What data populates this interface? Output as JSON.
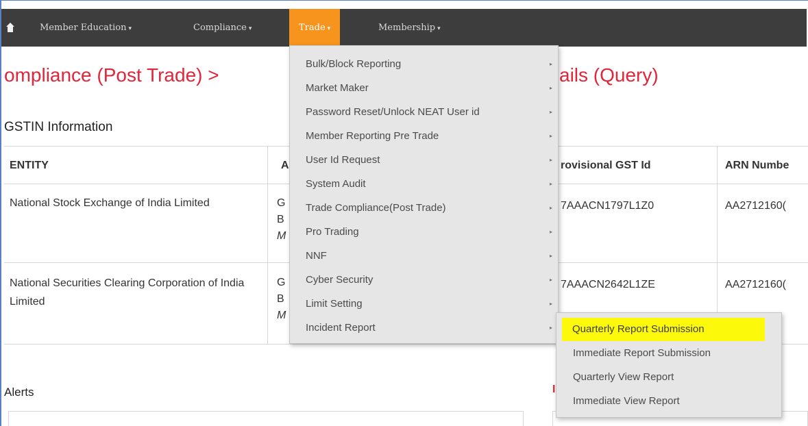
{
  "nav": {
    "items": [
      {
        "label": "Member Education",
        "caret": "▾"
      },
      {
        "label": "Compliance",
        "caret": "▾"
      },
      {
        "label": "Trade",
        "caret": "▾"
      },
      {
        "label": "Membership",
        "caret": "▾"
      }
    ],
    "active_color": "#f7941d"
  },
  "page": {
    "title": "ompliance (Post Trade) >",
    "title_tail": "ails (Query)",
    "title_color": "#e0263a"
  },
  "gstin": {
    "section_title": "GSTIN Information",
    "headers": {
      "entity": "ENTITY",
      "address": "A",
      "provisional": "rovisional GST Id",
      "arn": "ARN Numbe"
    },
    "rows": [
      {
        "entity": "National Stock Exchange of India Limited",
        "addr_line1": "G",
        "addr_line2": "B",
        "addr_line3": "M",
        "provisional": "7AAACN1797L1Z0",
        "arn": "AA2712160("
      },
      {
        "entity": "National Securities Clearing Corporation of India Limited",
        "addr_line1": "G",
        "addr_line2": "B",
        "addr_line3": "M",
        "provisional": "7AAACN2642L1ZE",
        "arn": "AA2712160("
      }
    ]
  },
  "alerts": {
    "title": "Alerts",
    "right_partial": "I"
  },
  "trade_menu": {
    "items": [
      {
        "label": "Bulk/Block Reporting",
        "arrow": "▸"
      },
      {
        "label": "Market Maker",
        "arrow": "▸"
      },
      {
        "label": "Password Reset/Unlock NEAT User id",
        "arrow": "▸"
      },
      {
        "label": "Member Reporting Pre Trade",
        "arrow": "▸"
      },
      {
        "label": "User Id Request",
        "arrow": "▸"
      },
      {
        "label": "System Audit",
        "arrow": "▸"
      },
      {
        "label": "Trade Compliance(Post Trade)",
        "arrow": "▸"
      },
      {
        "label": "Pro Trading",
        "arrow": "▸"
      },
      {
        "label": "NNF",
        "arrow": "▸"
      },
      {
        "label": "Cyber Security",
        "arrow": "▸"
      },
      {
        "label": "Limit Setting",
        "arrow": "▸"
      },
      {
        "label": "Incident Report",
        "arrow": "▸"
      }
    ]
  },
  "incident_submenu": {
    "items": [
      {
        "label": "Quarterly Report Submission",
        "highlighted": true
      },
      {
        "label": "Immediate Report Submission",
        "highlighted": false
      },
      {
        "label": "Quarterly View Report",
        "highlighted": false
      },
      {
        "label": "Immediate View Report",
        "highlighted": false
      }
    ],
    "highlight_color": "#fdf90a"
  }
}
